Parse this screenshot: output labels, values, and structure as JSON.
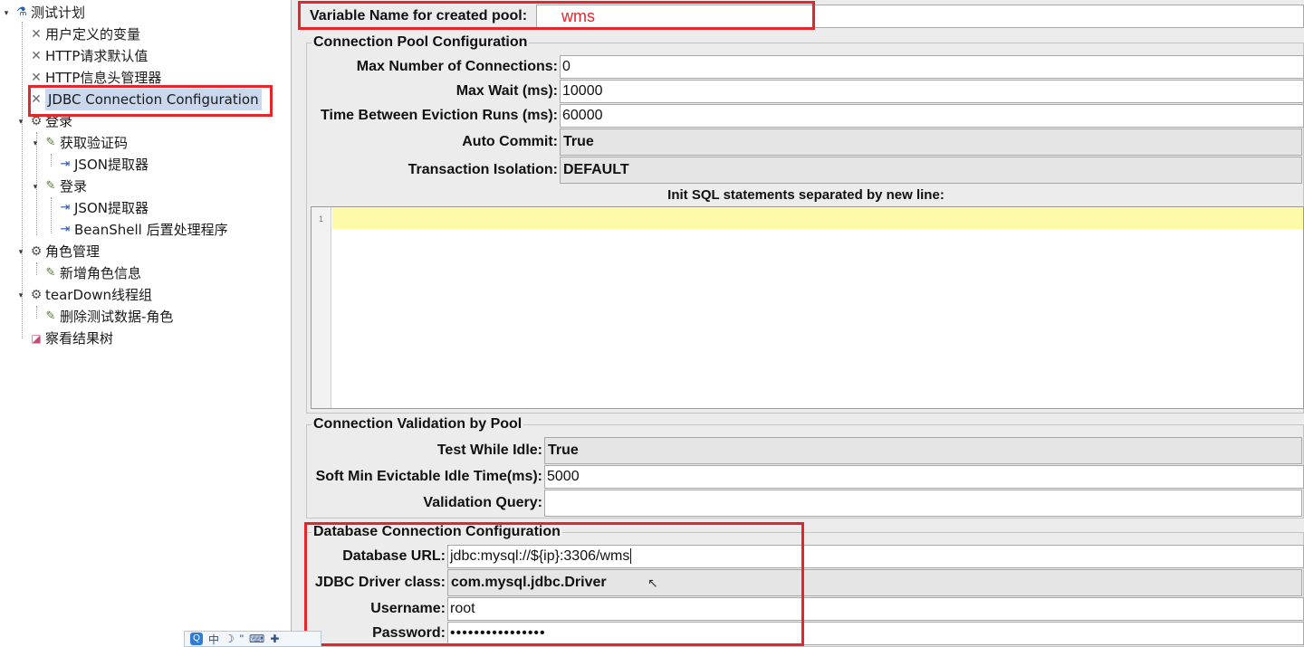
{
  "tree": {
    "items": [
      {
        "label": "测试计划",
        "icon": "flask-icon"
      },
      {
        "label": "用户定义的变量",
        "icon": "wrench-icon"
      },
      {
        "label": "HTTP请求默认值",
        "icon": "wrench-icon"
      },
      {
        "label": "HTTP信息头管理器",
        "icon": "wrench-icon"
      },
      {
        "label": "JDBC Connection Configuration",
        "icon": "wrench-icon"
      },
      {
        "label": "登录",
        "icon": "gear-icon"
      },
      {
        "label": "获取验证码",
        "icon": "pipette-icon"
      },
      {
        "label": "JSON提取器",
        "icon": "extractor-icon"
      },
      {
        "label": "登录",
        "icon": "pipette-icon"
      },
      {
        "label": "JSON提取器",
        "icon": "extractor-icon"
      },
      {
        "label": "BeanShell 后置处理程序",
        "icon": "extractor-icon"
      },
      {
        "label": "角色管理",
        "icon": "gear-icon"
      },
      {
        "label": "新增角色信息",
        "icon": "pipette-icon"
      },
      {
        "label": "tearDown线程组",
        "icon": "gear-icon"
      },
      {
        "label": "删除测试数据-角色",
        "icon": "pipette-icon"
      },
      {
        "label": "察看结果树",
        "icon": "chart-icon"
      }
    ]
  },
  "variable": {
    "label": "Variable Name for created pool:",
    "value": "",
    "annotation": "wms"
  },
  "pool": {
    "title": "Connection Pool Configuration",
    "max_connections_label": "Max Number of Connections:",
    "max_connections": "0",
    "max_wait_label": "Max Wait (ms):",
    "max_wait": "10000",
    "eviction_label": "Time Between Eviction Runs (ms):",
    "eviction": "60000",
    "auto_commit_label": "Auto Commit:",
    "auto_commit": "True",
    "isolation_label": "Transaction Isolation:",
    "isolation": "DEFAULT",
    "init_sql_label": "Init SQL statements separated by new line:",
    "line_number": "1"
  },
  "validation": {
    "title": "Connection Validation by Pool",
    "test_idle_label": "Test While Idle:",
    "test_idle": "True",
    "soft_min_label": "Soft Min Evictable Idle Time(ms):",
    "soft_min": "5000",
    "query_label": "Validation Query:",
    "query": ""
  },
  "database": {
    "title": "Database Connection Configuration",
    "url_label": "Database URL:",
    "url": "jdbc:mysql://${ip}:3306/wms",
    "driver_label": "JDBC Driver class:",
    "driver": "com.mysql.jdbc.Driver",
    "username_label": "Username:",
    "username": "root",
    "password_label": "Password:",
    "password": "••••••••••••••••"
  },
  "ime": {
    "logo": "Q",
    "mode": "中",
    "moon": "☽",
    "punct": "\"",
    "keyboard": "⌨",
    "tools": "✚"
  },
  "colors": {
    "annotation": "#e3262b",
    "selection": "#cad8ee",
    "editor_line": "#fdfaa8"
  }
}
